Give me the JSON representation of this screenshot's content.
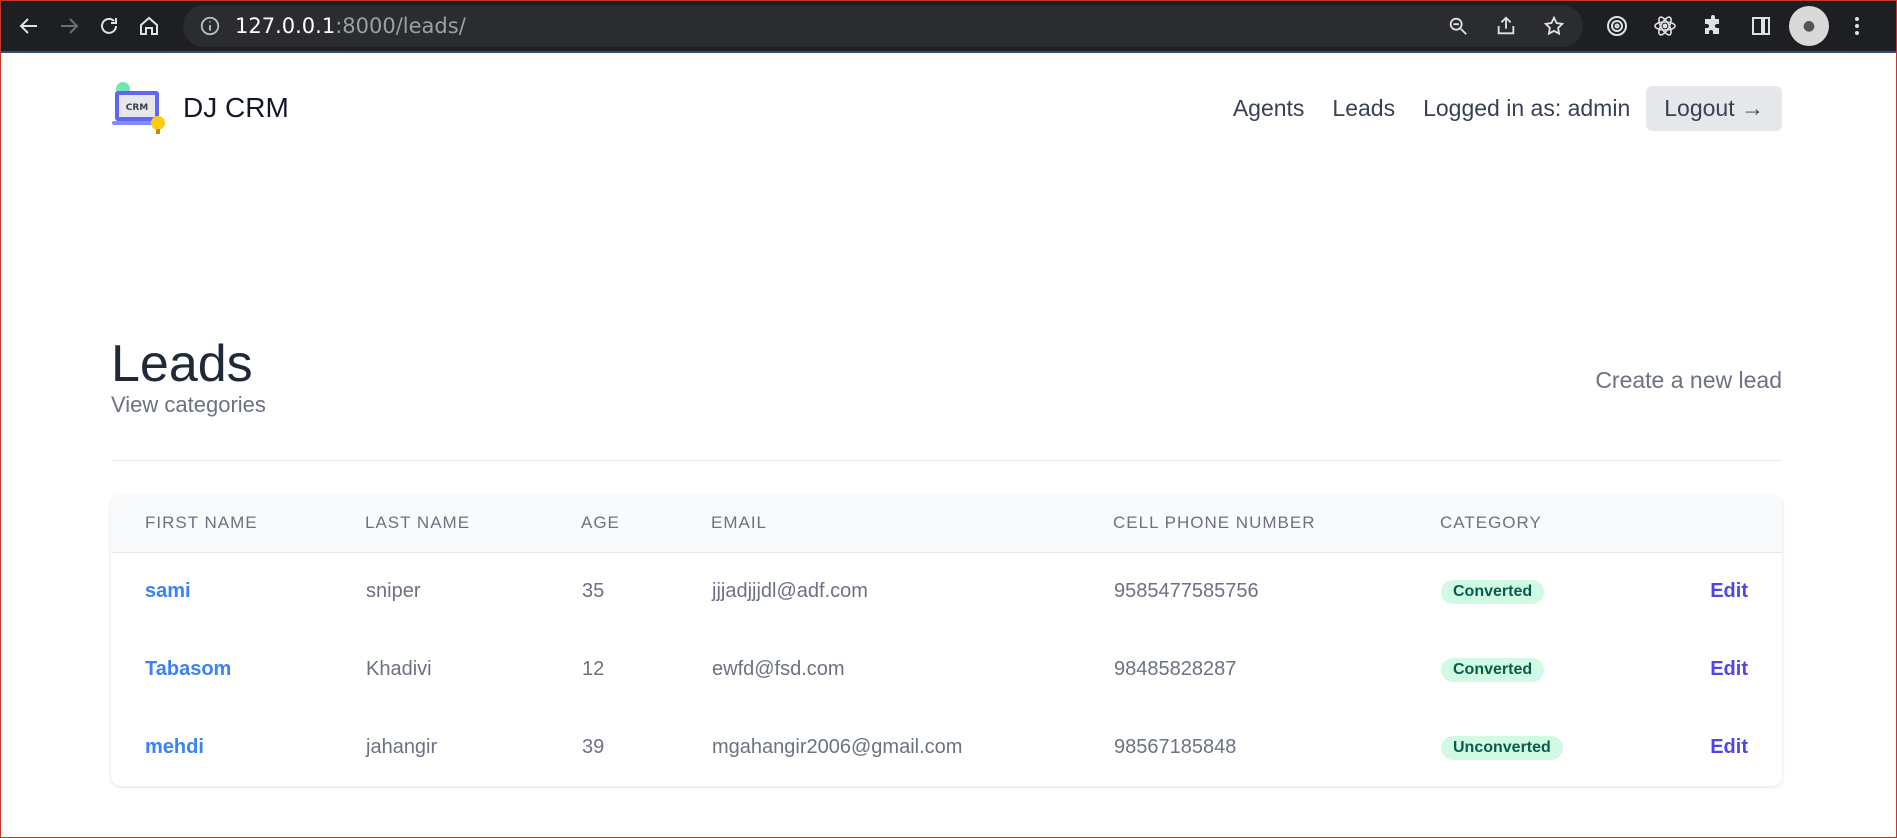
{
  "browser": {
    "url_host": "127.0.0.1",
    "url_path": ":8000/leads/",
    "icons": [
      "back-icon",
      "forward-icon",
      "reload-icon",
      "home-icon",
      "info-icon",
      "zoom-icon",
      "share-icon",
      "star-icon",
      "extension-target-icon",
      "react-icon",
      "puzzle-icon",
      "sidepanel-icon",
      "avatar",
      "menu-icon"
    ]
  },
  "site": {
    "brand": "DJ CRM",
    "nav": {
      "agents": "Agents",
      "leads": "Leads",
      "logged_in": "Logged in as: admin",
      "logout": "Logout →"
    }
  },
  "page": {
    "title": "Leads",
    "subtitle": "View categories",
    "create": "Create a new lead"
  },
  "table": {
    "headers": [
      "FIRST NAME",
      "LAST NAME",
      "AGE",
      "EMAIL",
      "CELL PHONE NUMBER",
      "CATEGORY"
    ],
    "rows": [
      {
        "first": "sami",
        "last": "sniper",
        "age": "35",
        "email": "jjjadjjjdl@adf.com",
        "phone": "9585477585756",
        "category": "Converted",
        "edit": "Edit"
      },
      {
        "first": "Tabasom",
        "last": "Khadivi",
        "age": "12",
        "email": "ewfd@fsd.com",
        "phone": "98485828287",
        "category": "Converted",
        "edit": "Edit"
      },
      {
        "first": "mehdi",
        "last": "jahangir",
        "age": "39",
        "email": "mgahangir2006@gmail.com",
        "phone": "98567185848",
        "category": "Unconverted",
        "edit": "Edit"
      }
    ]
  },
  "colors": {
    "link_blue": "#3b82f6",
    "edit_indigo": "#4f46e5",
    "badge_bg": "#d1fae5",
    "badge_text": "#065f46"
  }
}
